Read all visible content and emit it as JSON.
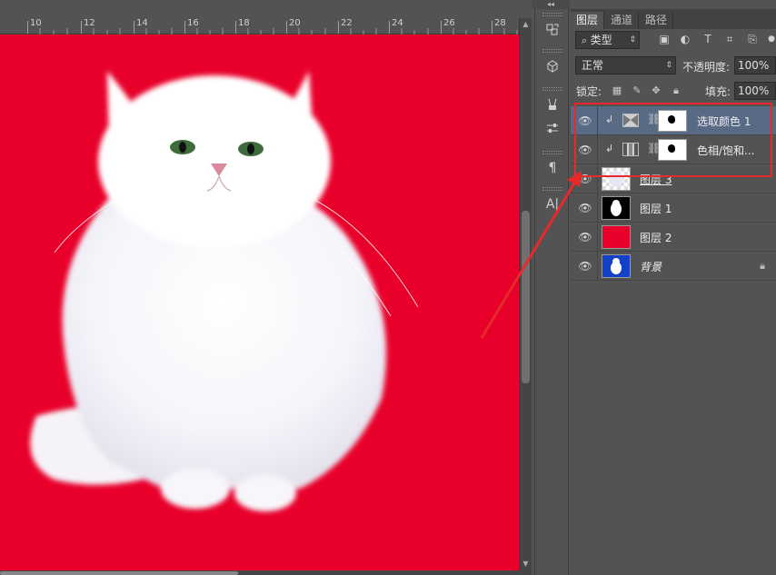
{
  "ruler": {
    "labels": [
      "10",
      "12",
      "14",
      "16",
      "18",
      "20",
      "22",
      "24",
      "26",
      "28"
    ]
  },
  "canvas": {
    "background_color": "#e8002a"
  },
  "tools": {
    "icons": [
      "layer-comps-icon",
      "3d-icon",
      "brush-presets-icon",
      "adjust-icon",
      "paragraph-icon",
      "character-icon"
    ]
  },
  "panel": {
    "tabs": [
      "图层",
      "通道",
      "路径"
    ],
    "filter": {
      "label": "类型"
    },
    "blend_mode": "正常",
    "opacity_label": "不透明度:",
    "opacity_value": "100%",
    "lock_label": "锁定:",
    "fill_label": "填充:",
    "fill_value": "100%"
  },
  "layers": [
    {
      "name": "选取颜色 1",
      "type": "adjustment",
      "selected": true
    },
    {
      "name": "色相/饱和...",
      "type": "adjustment",
      "selected": false
    },
    {
      "name": "图层 3",
      "type": "pixel",
      "selected": false
    },
    {
      "name": "图层 1",
      "type": "pixel",
      "selected": false
    },
    {
      "name": "图层 2",
      "type": "pixel",
      "selected": false
    },
    {
      "name": "背景",
      "type": "background",
      "selected": false
    }
  ],
  "colors": {
    "highlight": "#e8282a",
    "selected_row": "#596a85",
    "layer2_fill": "#e8002a",
    "background_fill": "#1540c8"
  }
}
